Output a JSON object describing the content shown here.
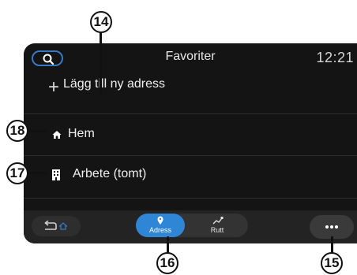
{
  "header": {
    "title": "Favoriter",
    "time": "12:21"
  },
  "list": {
    "add_label": "Lägg till ny adress",
    "home_label": "Hem",
    "work_label": "Arbete (tomt)"
  },
  "tabs": [
    {
      "label": "Adress",
      "icon": "location-pin-icon",
      "active": true
    },
    {
      "label": "Rutt",
      "icon": "route-icon",
      "active": false
    }
  ],
  "callouts": {
    "c14": "14",
    "c18": "18",
    "c17": "17",
    "c16": "16",
    "c15": "15"
  },
  "colors": {
    "screen_bg": "#141414",
    "accent": "#2f86d6",
    "search_outline": "#3a78c4"
  }
}
